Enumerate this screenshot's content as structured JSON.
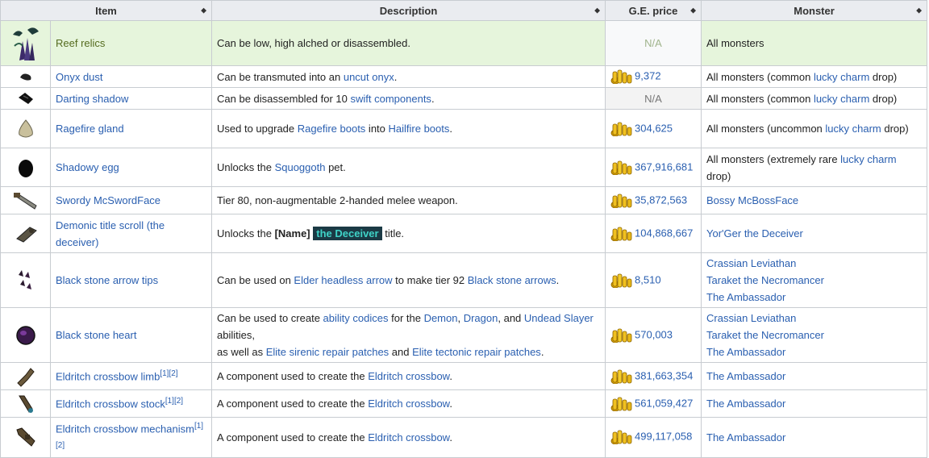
{
  "headers": {
    "item": "Item",
    "description": "Description",
    "price": "G.E. price",
    "monster": "Monster"
  },
  "rows": [
    {
      "name": "Reef relics",
      "desc": "Can be low, high alched or disassembled.",
      "price": "N/A",
      "monster": "All monsters"
    },
    {
      "name": "Onyx dust",
      "desc_pre": "Can be transmuted into an ",
      "desc_link": "uncut onyx",
      "desc_post": ".",
      "price": "9,372",
      "monster_pre": "All monsters (common ",
      "monster_link": "lucky charm",
      "monster_post": " drop)"
    },
    {
      "name": "Darting shadow",
      "desc_pre": "Can be disassembled for 10 ",
      "desc_link": "swift components",
      "desc_post": ".",
      "price": "N/A",
      "monster_pre": "All monsters (common ",
      "monster_link": "lucky charm",
      "monster_post": " drop)"
    },
    {
      "name": "Ragefire gland",
      "desc_pre": "Used to upgrade ",
      "desc_link1": "Ragefire boots",
      "desc_mid": " into ",
      "desc_link2": "Hailfire boots",
      "desc_post": ".",
      "price": "304,625",
      "monster_pre": "All monsters (uncommon ",
      "monster_link": "lucky charm",
      "monster_post": " drop)"
    },
    {
      "name": "Shadowy egg",
      "desc_pre": "Unlocks the ",
      "desc_link": "Squoggoth",
      "desc_post": " pet.",
      "price": "367,916,681",
      "monster_pre": "All monsters (extremely rare ",
      "monster_link": "lucky charm",
      "monster_post": " drop)"
    },
    {
      "name": "Swordy McSwordFace",
      "desc": "Tier 80, non-augmentable 2-handed melee weapon.",
      "price": "35,872,563",
      "monster": "Bossy McBossFace"
    },
    {
      "name": "Demonic title scroll (the deceiver)",
      "desc_pre": "Unlocks the ",
      "desc_bold": "[Name]",
      "desc_title": "the Deceiver",
      "desc_post": " title.",
      "price": "104,868,667",
      "monster": "Yor'Ger the Deceiver"
    },
    {
      "name": "Black stone arrow tips",
      "desc_pre": "Can be used on ",
      "desc_link1": "Elder headless arrow",
      "desc_mid": " to make tier 92 ",
      "desc_link2": "Black stone arrows",
      "desc_post": ".",
      "price": "8,510",
      "monsters": [
        "Crassian Leviathan",
        "Taraket the Necromancer",
        "The Ambassador"
      ]
    },
    {
      "name": "Black stone heart",
      "desc_l1_pre": "Can be used to create ",
      "desc_l1_link1": "ability codices",
      "desc_l1_mid": " for the ",
      "desc_l1_link2": "Demon",
      "desc_l1_sep1": ", ",
      "desc_l1_link3": "Dragon",
      "desc_l1_sep2": ", and ",
      "desc_l1_link4": "Undead Slayer",
      "desc_l2": "abilities,",
      "desc_l3_pre": "as well as ",
      "desc_l3_link1": "Elite sirenic repair patches",
      "desc_l3_mid": " and ",
      "desc_l3_link2": "Elite tectonic repair patches",
      "desc_l3_post": ".",
      "price": "570,003",
      "monsters": [
        "Crassian Leviathan",
        "Taraket the Necromancer",
        "The Ambassador"
      ]
    },
    {
      "name": "Eldritch crossbow limb",
      "ref": "[1][2]",
      "desc_pre": "A component used to create the ",
      "desc_link": "Eldritch crossbow",
      "desc_post": ".",
      "price": "381,663,354",
      "monster": "The Ambassador"
    },
    {
      "name": "Eldritch crossbow stock",
      "ref": "[1][2]",
      "desc_pre": "A component used to create the ",
      "desc_link": "Eldritch crossbow",
      "desc_post": ".",
      "price": "561,059,427",
      "monster": "The Ambassador"
    },
    {
      "name": "Eldritch crossbow mechanism",
      "ref": "[1][2]",
      "desc_pre": "A component used to create the ",
      "desc_link": "Eldritch crossbow",
      "desc_post": ".",
      "price": "499,117,058",
      "monster": "The Ambassador"
    }
  ],
  "icons": [
    "reef-relics-icon",
    "onyx-dust-icon",
    "darting-shadow-icon",
    "ragefire-gland-icon",
    "shadowy-egg-icon",
    "swordy-mcswordface-icon",
    "demonic-title-scroll-icon",
    "black-stone-arrow-tips-icon",
    "black-stone-heart-icon",
    "eldritch-crossbow-limb-icon",
    "eldritch-crossbow-stock-icon",
    "eldritch-crossbow-mechanism-icon",
    "coins-icon"
  ],
  "colors": {
    "link": "#2a5fb0",
    "header_bg": "#eaecf0",
    "highlight_row": "#e6f5dc",
    "title_bg": "#1b3a45",
    "title_text": "#3fd3c8"
  }
}
